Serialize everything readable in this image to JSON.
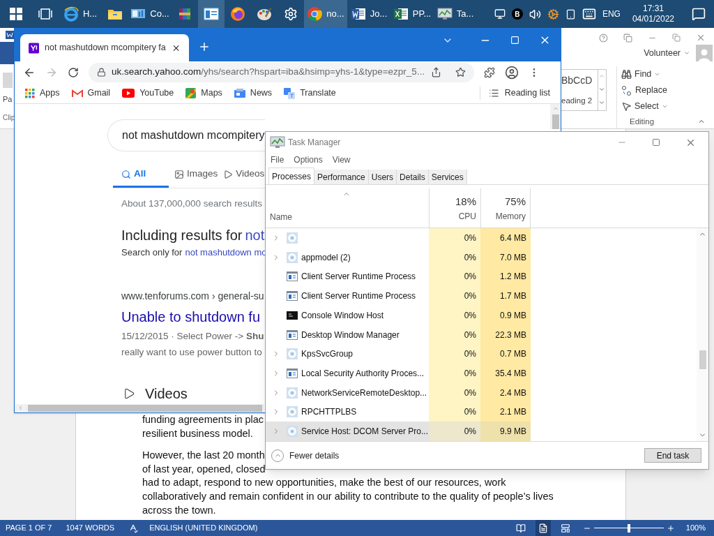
{
  "taskbar": {
    "items": [
      {
        "kind": "start",
        "active": false
      },
      {
        "kind": "taskview",
        "active": false
      },
      {
        "kind": "ie",
        "label": "H...",
        "active": false
      },
      {
        "kind": "explorer",
        "active": false
      },
      {
        "kind": "control",
        "label": "Co...",
        "active": false
      },
      {
        "kind": "archive",
        "active": false
      },
      {
        "kind": "window",
        "active": true
      },
      {
        "kind": "firefox",
        "active": false
      },
      {
        "kind": "paint",
        "active": false
      },
      {
        "kind": "settings",
        "active": false
      },
      {
        "kind": "chrome",
        "label": "no...",
        "active": true
      },
      {
        "kind": "word",
        "label": "Jo...",
        "active": false
      },
      {
        "kind": "excel",
        "label": "PP...",
        "active": false
      },
      {
        "kind": "taskmgr",
        "label": "Ta...",
        "active": false
      }
    ],
    "tray": [
      {
        "kind": "network"
      },
      {
        "kind": "badge",
        "label": "B"
      },
      {
        "kind": "volume"
      },
      {
        "kind": "gear"
      },
      {
        "kind": "tablet"
      },
      {
        "kind": "keyboard"
      },
      {
        "kind": "text",
        "label": "ENG"
      }
    ],
    "time": "17:31",
    "date": "04/01/2022"
  },
  "word": {
    "left_labels": [
      "Pa",
      "Clip"
    ],
    "user": "Volunteer",
    "styles": [
      "BbCcD",
      "eading 2"
    ],
    "editing": {
      "items": [
        {
          "kind": "find",
          "label": "Find",
          "dropdown": true
        },
        {
          "kind": "replace",
          "label": "Replace",
          "dropdown": false
        },
        {
          "kind": "select",
          "label": "Select",
          "dropdown": true
        }
      ],
      "label": "Editing"
    },
    "paragraphs": [
      [
        "funding agreements in plac",
        "resilient business model."
      ],
      [
        "However, the last 20 month",
        "of last year, opened, closed",
        "had to adapt, respond to new opportunities, make the best of our resources, work",
        "collaboratively and remain confident in our ability to contribute to the quality of people’s lives",
        "across the town."
      ]
    ],
    "status": {
      "page": "PAGE 1 OF 7",
      "words": "1047 WORDS",
      "language": "ENGLISH (UNITED KINGDOM)",
      "zoom": {
        "level": 0.5,
        "label": "100%"
      }
    }
  },
  "chrome": {
    "tab": {
      "title": "not mashutdown mcompitery fa"
    },
    "url": {
      "host": "uk.search.yahoo.com",
      "path": "/yhs/search?hspart=iba&hsimp=yhs-1&type=ezpr_5..."
    },
    "bookmarks": [
      {
        "kind": "apps",
        "label": "Apps"
      },
      {
        "kind": "gmail",
        "label": "Gmail"
      },
      {
        "kind": "youtube",
        "label": "YouTube"
      },
      {
        "kind": "maps",
        "label": "Maps"
      },
      {
        "kind": "news",
        "label": "News"
      },
      {
        "kind": "translate",
        "label": "Translate"
      }
    ],
    "reading_list": "Reading list",
    "page": {
      "query": "not mashutdown mcompitery",
      "tabs": [
        {
          "kind": "search",
          "label": "All",
          "selected": true
        },
        {
          "kind": "image",
          "label": "Images",
          "selected": false
        },
        {
          "kind": "video",
          "label": "Videos",
          "selected": false
        }
      ],
      "result_count": "About 137,000,000 search results",
      "including": {
        "prefix": "Including results for",
        "link": "not"
      },
      "search_only": {
        "prefix": "Search only for",
        "link": "not mashutdown mo"
      },
      "result": {
        "breadcrumb": "www.tenforums.com › general-su",
        "title": "Unable to shutdown fu",
        "snippet": [
          "15/12/2015 · Select Power -> **Shu**",
          "really want to use power button to"
        ]
      },
      "section": "Videos"
    }
  },
  "task_manager": {
    "title": "Task Manager",
    "menu": [
      "File",
      "Options",
      "View"
    ],
    "tabs": [
      {
        "label": "Processes",
        "selected": true
      },
      {
        "label": "Performance",
        "selected": false
      },
      {
        "label": "Users",
        "selected": false
      },
      {
        "label": "Details",
        "selected": false
      },
      {
        "label": "Services",
        "selected": false
      }
    ],
    "columns": {
      "name": "Name",
      "cpu": {
        "total": "18%",
        "label": "CPU"
      },
      "memory": {
        "total": "75%",
        "label": "Memory"
      }
    },
    "rows": [
      {
        "kind": "service",
        "expandable": true,
        "cpu": "0%",
        "memory": "6.4 MB",
        "selected": false
      },
      {
        "kind": "service",
        "expandable": true,
        "name": "appmodel (2)",
        "cpu": "0%",
        "memory": "7.0 MB",
        "selected": false
      },
      {
        "kind": "app",
        "expandable": false,
        "name": "Client Server Runtime Process",
        "cpu": "0%",
        "memory": "1.2 MB",
        "selected": false
      },
      {
        "kind": "app",
        "expandable": false,
        "name": "Client Server Runtime Process",
        "cpu": "0%",
        "memory": "1.7 MB",
        "selected": false
      },
      {
        "kind": "console",
        "expandable": false,
        "name": "Console Window Host",
        "cpu": "0%",
        "memory": "0.9 MB",
        "selected": false
      },
      {
        "kind": "app",
        "expandable": false,
        "name": "Desktop Window Manager",
        "cpu": "0%",
        "memory": "22.3 MB",
        "selected": false
      },
      {
        "kind": "service",
        "expandable": true,
        "name": "KpsSvcGroup",
        "cpu": "0%",
        "memory": "0.7 MB",
        "selected": false
      },
      {
        "kind": "app",
        "expandable": true,
        "name": "Local Security Authority Proces...",
        "cpu": "0%",
        "memory": "35.4 MB",
        "selected": false
      },
      {
        "kind": "service",
        "expandable": true,
        "name": "NetworkServiceRemoteDesktop...",
        "cpu": "0%",
        "memory": "2.4 MB",
        "selected": false
      },
      {
        "kind": "service",
        "expandable": true,
        "name": "RPCHTTPLBS",
        "cpu": "0%",
        "memory": "2.1 MB",
        "selected": false
      },
      {
        "kind": "service",
        "expandable": true,
        "name": "Service Host: DCOM Server Pro...",
        "cpu": "0%",
        "memory": "9.9 MB",
        "selected": true
      }
    ],
    "footer": {
      "toggle": "Fewer details",
      "button": "End task"
    }
  }
}
